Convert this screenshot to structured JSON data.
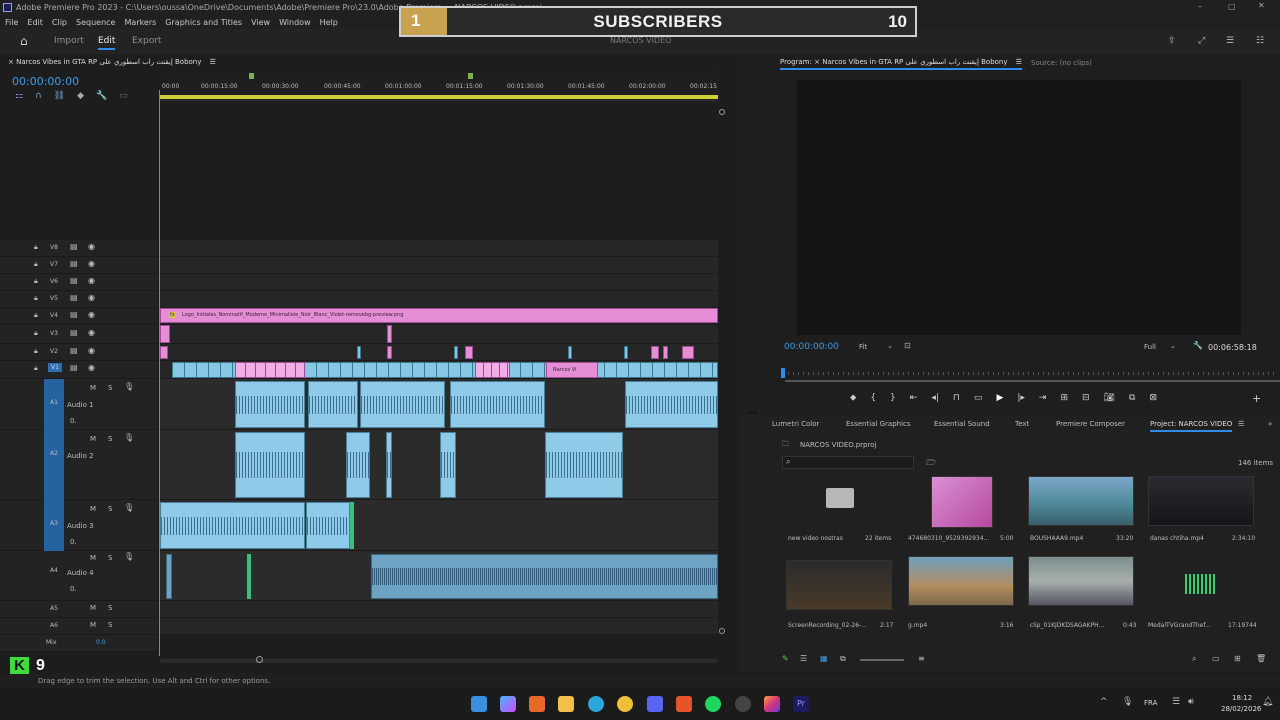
{
  "titlebar": {
    "title": "Adobe Premiere Pro 2023 - C:\\Users\\oussa\\OneDrive\\Documents\\Adobe\\Premiere Pro\\23.0\\Adobe Premiere ... NARCOS VIDEO.prproj"
  },
  "menu": [
    "File",
    "Edit",
    "Clip",
    "Sequence",
    "Markers",
    "Graphics and Titles",
    "View",
    "Window",
    "Help"
  ],
  "nav": {
    "import": "Import",
    "edit": "Edit",
    "export": "Export",
    "project_name": "NARCOS VIDEO"
  },
  "overlay": {
    "left": "1",
    "title": "SUBSCRIBERS",
    "right": "10"
  },
  "timeline": {
    "sequence_tab": "× Narcos Vibes in GTA RP إيقنت راب اسطوري على Bobony",
    "timecode": "00:00:00:00",
    "ruler": [
      "00:00",
      "00:00:15:00",
      "00:00:30:00",
      "00:00:45:00",
      "00:01:00:00",
      "00:01:15:00",
      "00:01:30:00",
      "00:01:45:00",
      "00:02:00:00",
      "00:02:15"
    ],
    "video_tracks": [
      "V8",
      "V7",
      "V6",
      "V5",
      "V4",
      "V3",
      "V2",
      "V1"
    ],
    "audio_tracks": [
      {
        "id": "A1",
        "name": "Audio 1",
        "vol": "0."
      },
      {
        "id": "A2",
        "name": "Audio 2",
        "vol": ""
      },
      {
        "id": "A3",
        "name": "Audio 3",
        "vol": "0."
      },
      {
        "id": "A4",
        "name": "Audio 4",
        "vol": "0."
      },
      {
        "id": "A5",
        "name": "",
        "vol": ""
      },
      {
        "id": "A6",
        "name": "",
        "vol": ""
      }
    ],
    "mix_label": "Mix",
    "mix_value": "0.0",
    "v4_clip": "Logo_Initiales_Nominatif_Moderne_Minimaliste_Noir_Blanc_Violet-removebg-preview.png",
    "v1_clip": "Narcos Vi"
  },
  "program": {
    "tab": "Program: × Narcos Vibes in GTA RP إيقنت راب اسطوري على Bobony",
    "source_tab": "Source: (no clips)",
    "timecode": "00:00:00:00",
    "fit": "Fit",
    "full": "Full",
    "duration": "00:06:58:18"
  },
  "project": {
    "tabs": [
      "Lumetri Color",
      "Essential Graphics",
      "Essential Sound",
      "Text",
      "Premiere Composer",
      "Project: NARCOS VIDEO"
    ],
    "file": "NARCOS VIDEO.prproj",
    "items_count": "146 items",
    "items": [
      {
        "name": "new video nostras",
        "meta": "22 items"
      },
      {
        "name": "474680310_9529392934...",
        "meta": "5:00"
      },
      {
        "name": "BOUSHAAA9.mp4",
        "meta": "33:20"
      },
      {
        "name": "danas chtiha.mp4",
        "meta": "2:34:10"
      },
      {
        "name": "ScreenRecording_02-26-...",
        "meta": "2:17"
      },
      {
        "name": "g.mp4",
        "meta": "3:16"
      },
      {
        "name": "clip_01KJDKDSAGAKPH...",
        "meta": "0:43"
      },
      {
        "name": "MedalTVGrandThef...",
        "meta": "17:19744"
      }
    ]
  },
  "status": {
    "hint": "Drag edge to trim the selection. Use Alt and Ctrl for other options."
  },
  "taskbar": {
    "lang": "FRA",
    "time": "18:12",
    "date": "28/02/2026"
  },
  "logo": {
    "text": "9"
  }
}
